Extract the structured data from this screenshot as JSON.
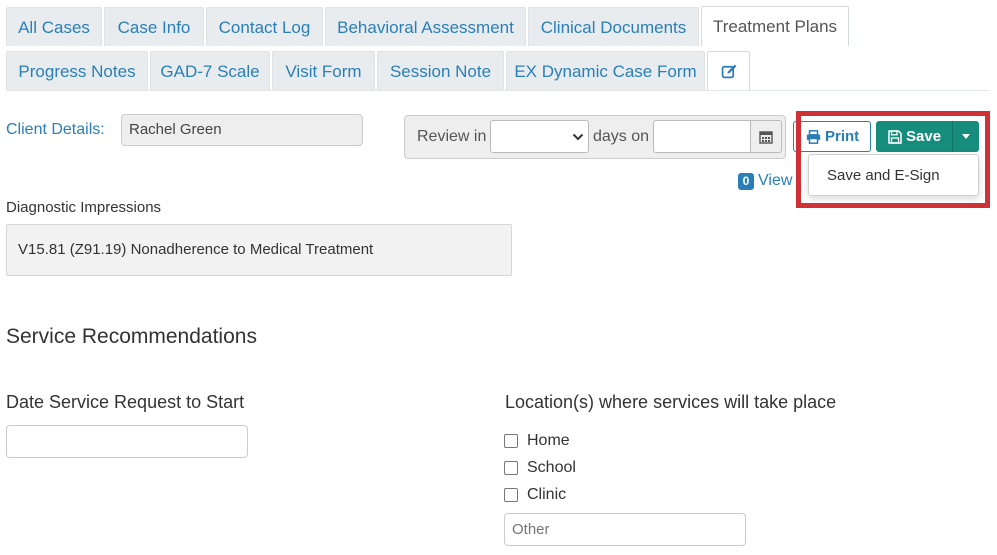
{
  "tabs_row1": [
    {
      "label": "All Cases"
    },
    {
      "label": "Case Info"
    },
    {
      "label": "Contact Log"
    },
    {
      "label": "Behavioral Assessment"
    },
    {
      "label": "Clinical Documents"
    },
    {
      "label": "Treatment Plans",
      "active": true
    }
  ],
  "tabs_row2": [
    {
      "label": "Progress Notes"
    },
    {
      "label": "GAD-7 Scale"
    },
    {
      "label": "Visit Form"
    },
    {
      "label": "Session Note"
    },
    {
      "label": "EX Dynamic Case Form"
    },
    {
      "icon": "edit-icon"
    }
  ],
  "client": {
    "label": "Client Details:",
    "name": "Rachel Green"
  },
  "review": {
    "prefix": "Review in",
    "selected_days": "",
    "suffix": "days on",
    "date_value": ""
  },
  "actions": {
    "print_label": "Print",
    "save_label": "Save",
    "save_menu": [
      "Save and E-Sign"
    ],
    "view_count": "0",
    "view_label": "View"
  },
  "diagnostic": {
    "heading": "Diagnostic Impressions",
    "value": "V15.81 (Z91.19) Nonadherence to Medical Treatment"
  },
  "service": {
    "heading": "Service Recommendations",
    "date_label": "Date Service Request to Start",
    "date_value": "",
    "location_label": "Location(s) where services will take place",
    "locations": [
      "Home",
      "School",
      "Clinic"
    ],
    "other_placeholder": "Other"
  },
  "colors": {
    "link": "#2a7fb8",
    "save_button": "#168d7c",
    "highlight_frame": "#cf3137"
  }
}
